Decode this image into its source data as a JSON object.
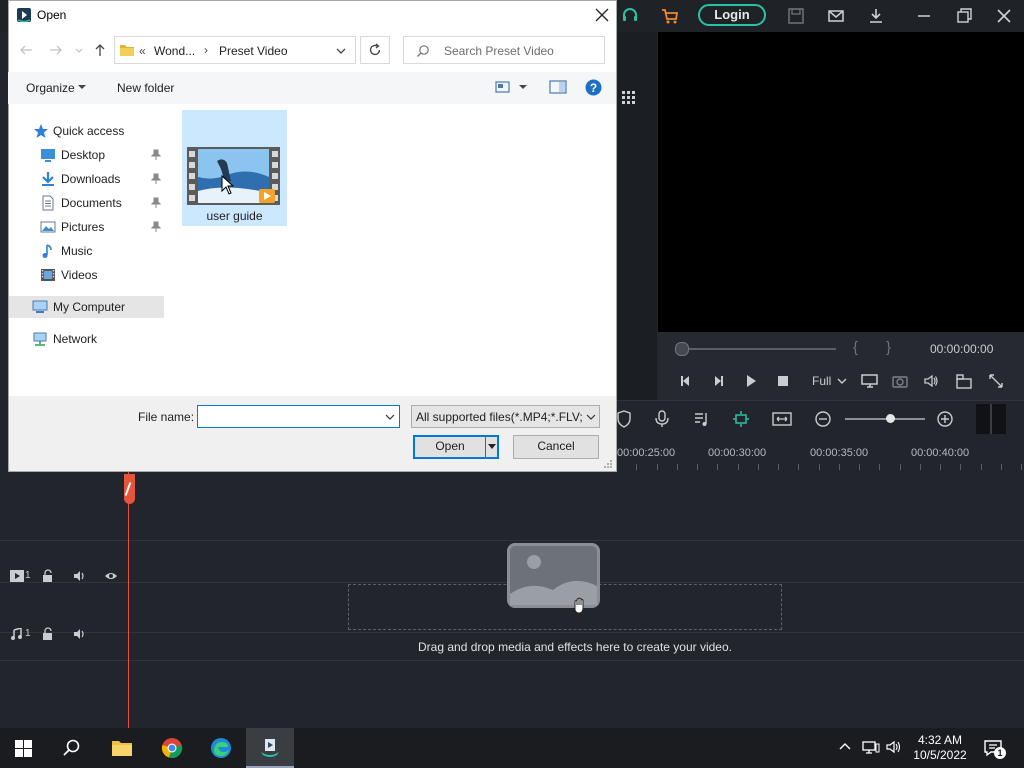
{
  "app": {
    "login_label": "Login",
    "preview": {
      "time": "00:00:00:00",
      "brace_open": "{",
      "brace_close": "}",
      "quality_label": "Full"
    },
    "timeline": {
      "ruler_labels": [
        "00:00:25:00",
        "00:00:30:00",
        "00:00:35:00",
        "00:00:40:00"
      ],
      "video_track_number": "1",
      "audio_track_number": "1",
      "drop_message": "Drag and drop media and effects here to create your video.",
      "playhead_color": "#e6553b"
    },
    "accent": "#2ac1a6"
  },
  "dialog": {
    "title": "Open",
    "breadcrumb": {
      "overflow": "«",
      "parent": "Wond...",
      "separator": "›",
      "current": "Preset Video"
    },
    "search_placeholder": "Search Preset Video",
    "toolbar": {
      "organize_label": "Organize",
      "new_folder_label": "New folder"
    },
    "nav": {
      "quick_access": "Quick access",
      "items": [
        {
          "label": "Desktop",
          "icon": "desktop-icon",
          "pinned": true
        },
        {
          "label": "Downloads",
          "icon": "downloads-icon",
          "pinned": true
        },
        {
          "label": "Documents",
          "icon": "documents-icon",
          "pinned": true
        },
        {
          "label": "Pictures",
          "icon": "pictures-icon",
          "pinned": true
        },
        {
          "label": "Music",
          "icon": "music-icon",
          "pinned": false
        },
        {
          "label": "Videos",
          "icon": "videos-icon",
          "pinned": false
        }
      ],
      "my_computer": "My Computer",
      "network": "Network"
    },
    "files": [
      {
        "name": "user guide",
        "icon": "video-file-icon",
        "selected": true
      }
    ],
    "file_name_label": "File name:",
    "file_name_value": "",
    "filter_value": "All supported files(*.MP4;*.FLV;",
    "open_label": "Open",
    "cancel_label": "Cancel"
  },
  "taskbar": {
    "time": "4:32 AM",
    "date": "10/5/2022",
    "notification_count": "1"
  }
}
